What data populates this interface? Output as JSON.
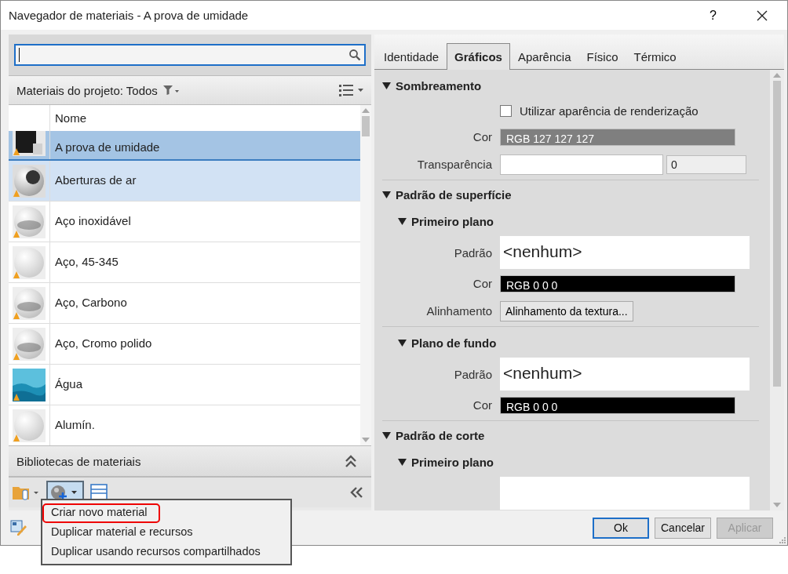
{
  "window": {
    "title": "Navegador de materiais - A prova de umidade",
    "help": "?"
  },
  "browser": {
    "header": "Materiais do projeto: Todos",
    "columns": [
      "Nome"
    ],
    "rows": [
      {
        "name": "A prova de umidade",
        "kind": "dark",
        "selected": true,
        "highlighted": false
      },
      {
        "name": "Aberturas de ar",
        "kind": "vent",
        "selected": false,
        "highlighted": true
      },
      {
        "name": "Aço inoxidável",
        "kind": "chrome",
        "selected": false,
        "highlighted": false
      },
      {
        "name": "Aço, 45-345",
        "kind": "matte",
        "selected": false,
        "highlighted": false
      },
      {
        "name": "Aço, Carbono",
        "kind": "chrome",
        "selected": false,
        "highlighted": false
      },
      {
        "name": "Aço, Cromo polido",
        "kind": "chrome",
        "selected": false,
        "highlighted": false
      },
      {
        "name": "Água",
        "kind": "water",
        "selected": false,
        "highlighted": false
      },
      {
        "name": "Alumín.",
        "kind": "matte",
        "selected": false,
        "highlighted": false
      }
    ],
    "libraries": "Bibliotecas de materiais"
  },
  "menu": {
    "items": [
      {
        "label": "Criar novo material",
        "highlighted": true
      },
      {
        "label": "Duplicar material e recursos",
        "highlighted": false
      },
      {
        "label": "Duplicar usando recursos compartilhados",
        "highlighted": false
      }
    ]
  },
  "tabs": [
    {
      "label": "Identidade",
      "selected": false
    },
    {
      "label": "Gráficos",
      "selected": true
    },
    {
      "label": "Aparência",
      "selected": false
    },
    {
      "label": "Físico",
      "selected": false
    },
    {
      "label": "Térmico",
      "selected": false
    }
  ],
  "sections": [
    {
      "title": "Sombreamento",
      "expanded": true,
      "rows": [
        {
          "kind": "checkbox",
          "label": "Utilizar aparência de renderização",
          "checked": false
        },
        {
          "kind": "color",
          "label": "Cor",
          "value": "RGB 127 127 127",
          "color": "#7f7f7f"
        },
        {
          "kind": "slider",
          "label": "Transparência",
          "value": "0"
        }
      ]
    },
    {
      "title": "Padrão de superfície",
      "expanded": true,
      "subsections": [
        {
          "title": "Primeiro plano",
          "expanded": true,
          "rows": [
            {
              "kind": "pattern",
              "label": "Padrão",
              "value": "<nenhum>"
            },
            {
              "kind": "color",
              "label": "Cor",
              "value": "RGB 0 0 0",
              "color": "#000000"
            },
            {
              "kind": "button",
              "label": "Alinhamento",
              "value": "Alinhamento da textura..."
            }
          ]
        },
        {
          "title": "Plano de fundo",
          "expanded": true,
          "rows": [
            {
              "kind": "pattern",
              "label": "Padrão",
              "value": "<nenhum>"
            },
            {
              "kind": "color",
              "label": "Cor",
              "value": "RGB 0 0 0",
              "color": "#000000"
            }
          ]
        }
      ]
    },
    {
      "title": "Padrão de corte",
      "expanded": true,
      "subsections": [
        {
          "title": "Primeiro plano",
          "expanded": true,
          "rows": [
            {
              "kind": "pattern"
            }
          ]
        }
      ]
    }
  ],
  "buttons": [
    {
      "label": "Ok",
      "kind": "default",
      "disabled": false
    },
    {
      "label": "Cancelar",
      "kind": "normal",
      "disabled": false
    },
    {
      "label": "Aplicar",
      "kind": "normal",
      "disabled": true
    }
  ]
}
